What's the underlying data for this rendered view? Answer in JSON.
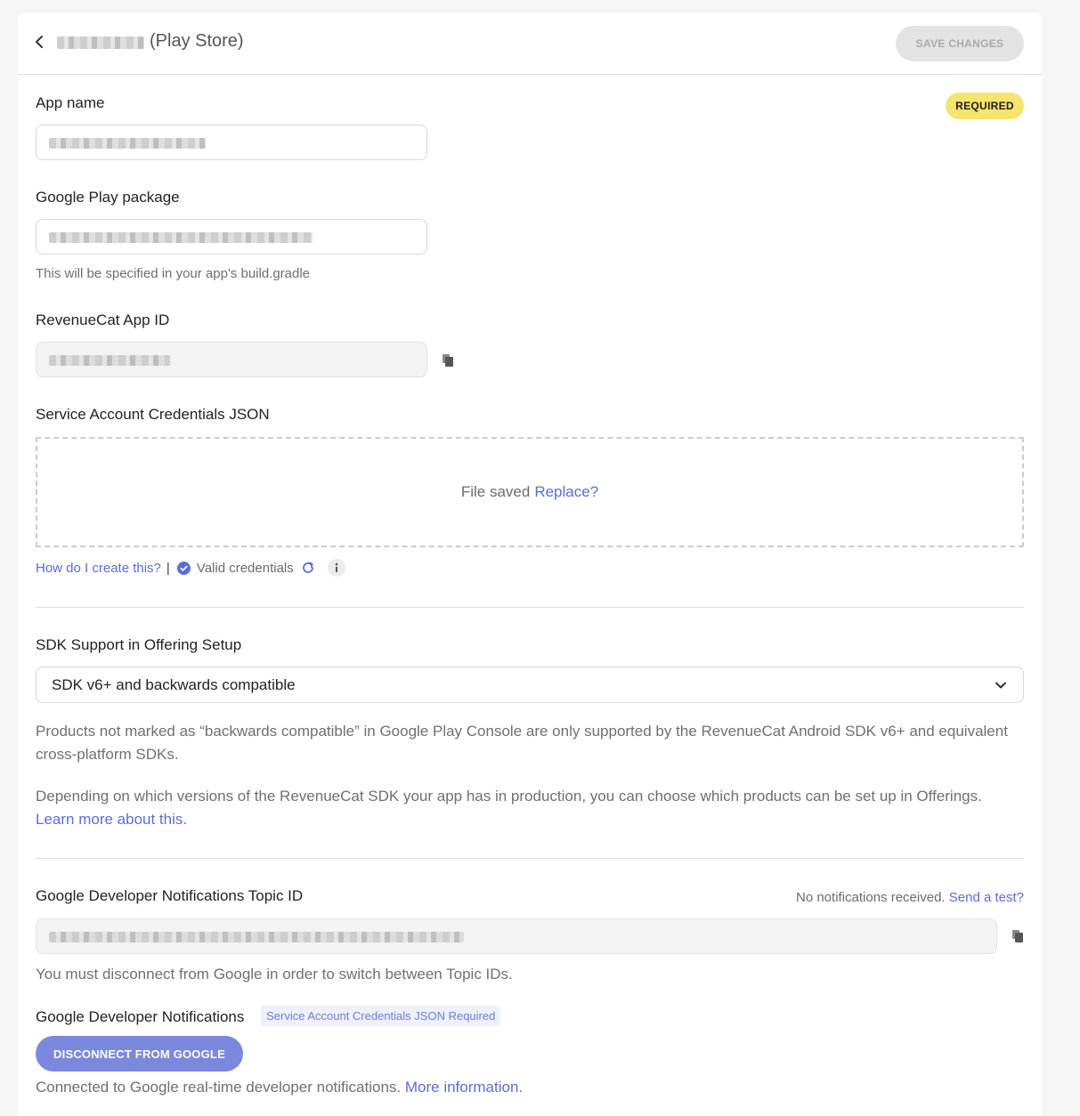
{
  "header": {
    "title_suffix": "(Play Store)",
    "save_label": "SAVE CHANGES"
  },
  "app_name": {
    "label": "App name",
    "badge": "REQUIRED"
  },
  "package": {
    "label": "Google Play package",
    "help": "This will be specified in your app's build.gradle"
  },
  "app_id": {
    "label": "RevenueCat App ID"
  },
  "credentials": {
    "label": "Service Account Credentials JSON",
    "file_status": "File saved",
    "replace_label": "Replace?",
    "how_link": "How do I create this?",
    "separator": "|",
    "valid_text": "Valid credentials"
  },
  "sdk": {
    "label": "SDK Support in Offering Setup",
    "selected": "SDK v6+ and backwards compatible",
    "para1": "Products not marked as “backwards compatible” in Google Play Console are only supported by the RevenueCat Android SDK v6+ and equivalent cross-platform SDKs.",
    "para2": "Depending on which versions of the RevenueCat SDK your app has in production, you can choose which products can be set up in Offerings.",
    "learn_more": "Learn more about this",
    "period": "."
  },
  "topic": {
    "label": "Google Developer Notifications Topic ID",
    "status": "No notifications received.",
    "send_test": "Send a test?",
    "help": "You must disconnect from Google in order to switch between Topic IDs."
  },
  "notifications": {
    "label": "Google Developer Notifications",
    "pill": "Service Account Credentials JSON Required",
    "disconnect_label": "DISCONNECT FROM GOOGLE",
    "connected_text": "Connected to Google real-time developer notifications.",
    "more_info": "More information",
    "period": "."
  },
  "colors": {
    "accent": "#5b6cd6",
    "required_badge": "#f5e46f",
    "disconnect_button": "#7a89de"
  },
  "icons": [
    "chevron-left-icon",
    "copy-icon",
    "check-circle-icon",
    "refresh-icon",
    "info-icon",
    "chevron-down-icon"
  ]
}
